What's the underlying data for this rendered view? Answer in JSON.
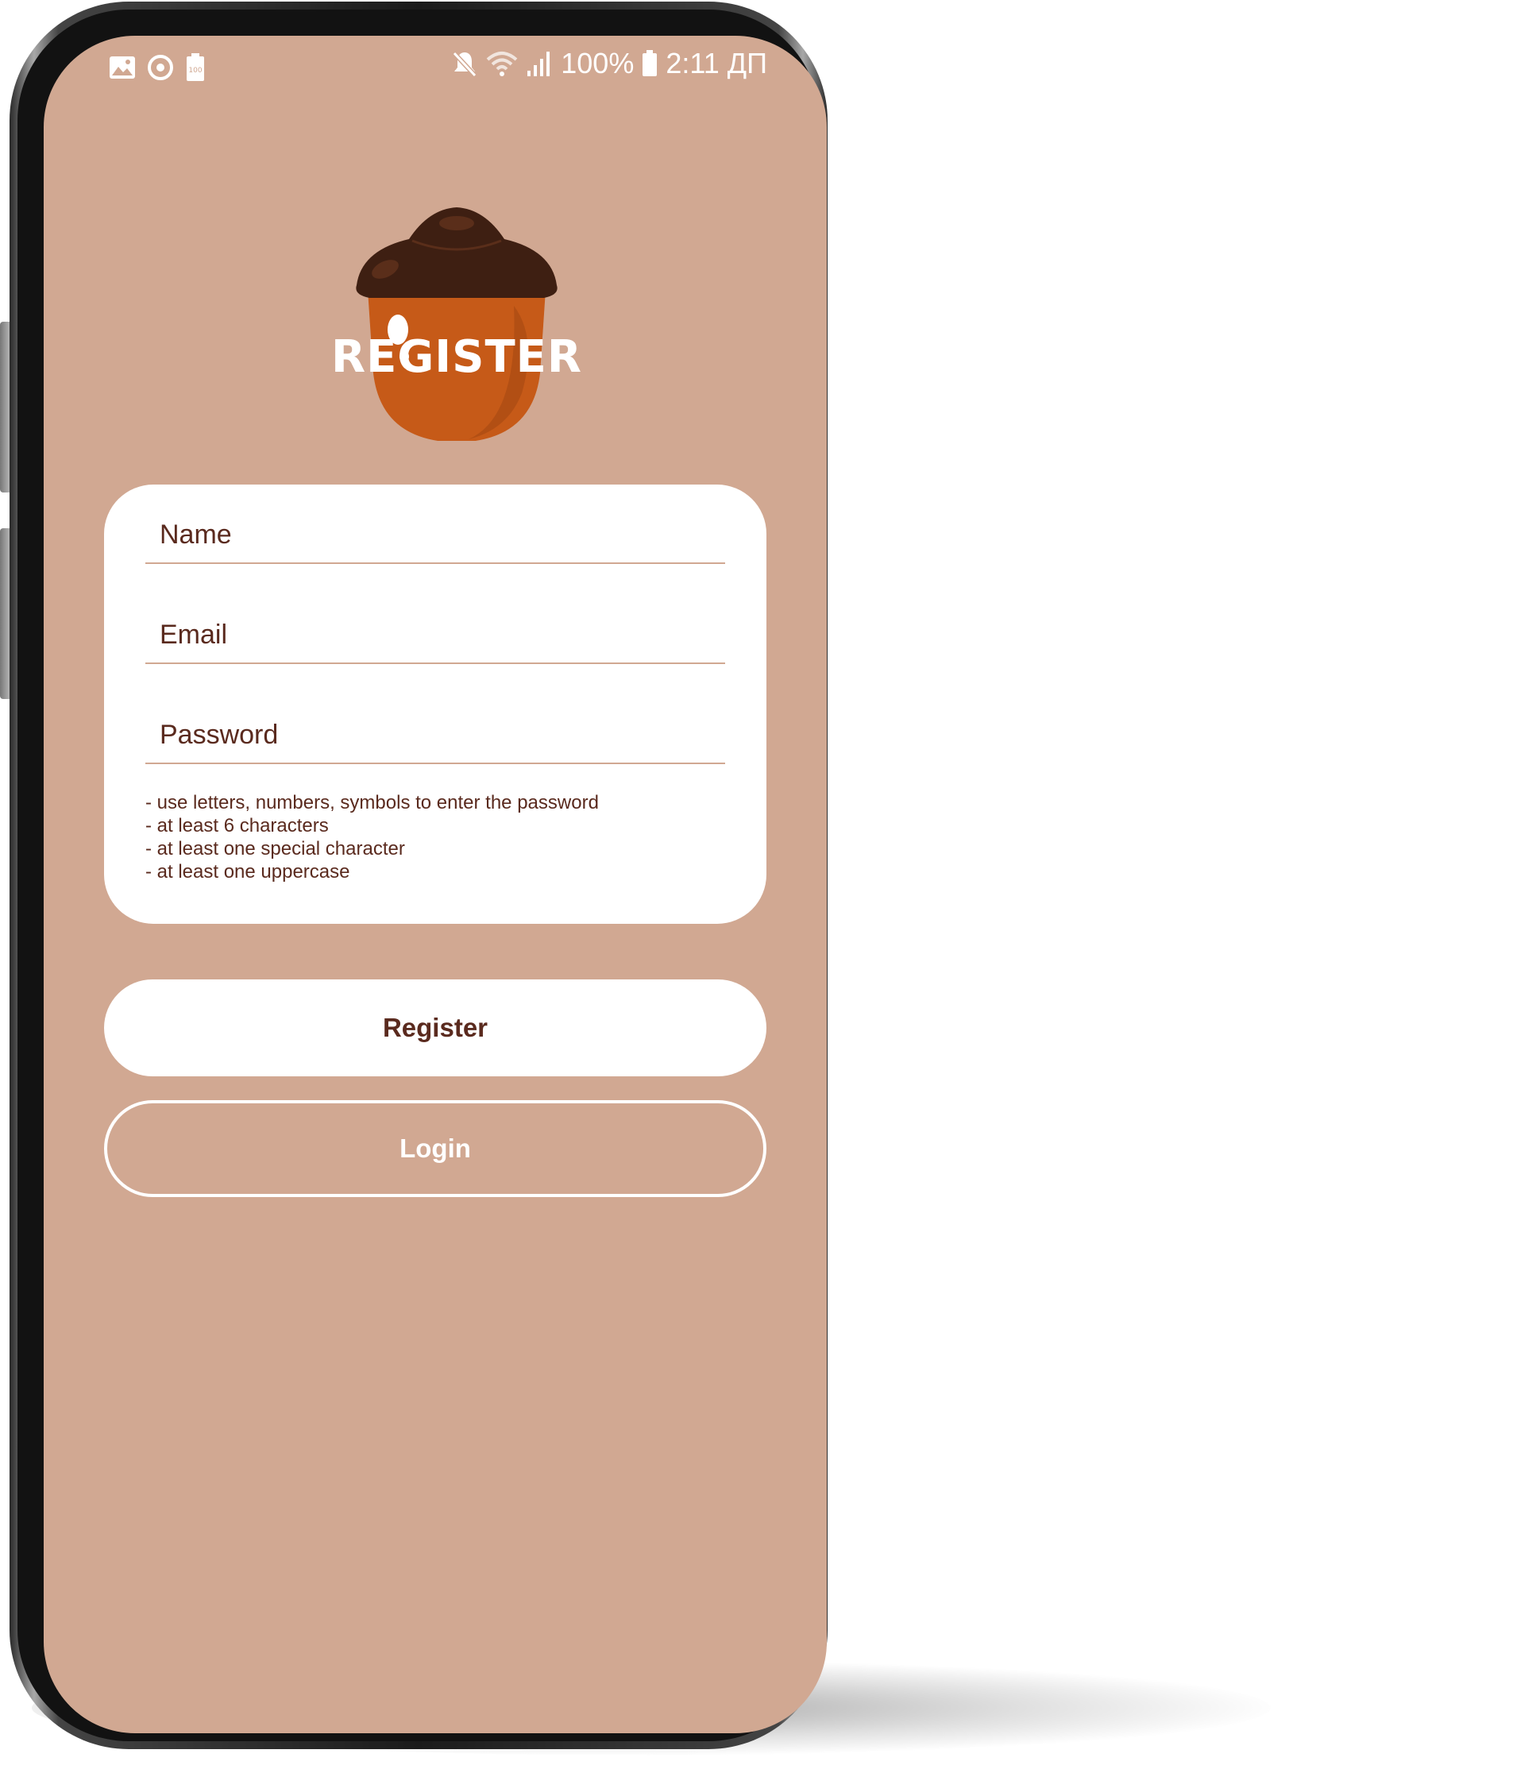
{
  "status_bar": {
    "battery_percent": "100%",
    "time": "2:11",
    "period": "ДП",
    "left_icons": [
      "image-icon",
      "sync-icon",
      "battery-saver-icon"
    ],
    "right_icons": [
      "mute-icon",
      "wifi-icon",
      "signal-icon",
      "battery-icon"
    ]
  },
  "logo": {
    "title": "REGISTER",
    "icon": "acorn-icon"
  },
  "form": {
    "name_placeholder": "Name",
    "email_placeholder": "Email",
    "password_placeholder": "Password",
    "hints": [
      "- use letters, numbers, symbols to enter the password",
      "- at least 6 characters",
      "- at least one special character",
      "- at least one uppercase"
    ]
  },
  "buttons": {
    "register": "Register",
    "login": "Login"
  },
  "colors": {
    "background": "#d1a892",
    "text": "#5a2a1e",
    "acorn_cap": "#3e1f12",
    "acorn_body": "#c65a18",
    "card": "#ffffff"
  }
}
